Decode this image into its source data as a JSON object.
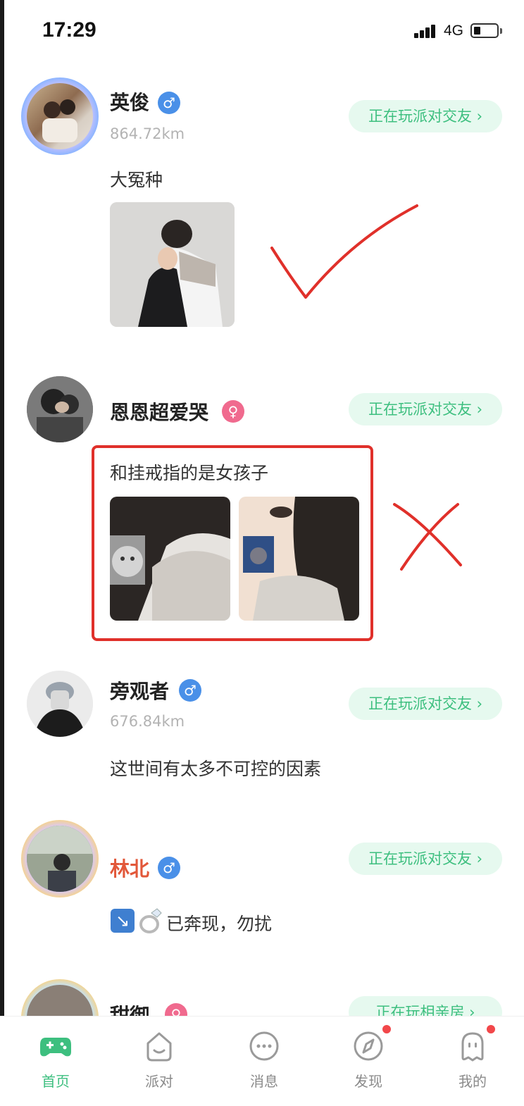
{
  "status_bar": {
    "time": "17:29",
    "network": "4G"
  },
  "posts": [
    {
      "username": "英俊",
      "gender": "male",
      "distance": "864.72km",
      "party_label": "正在玩派对交友",
      "text": "大冤种"
    },
    {
      "username": "恩恩超爱哭",
      "gender": "female",
      "party_label": "正在玩派对交友",
      "text": "和挂戒指的是女孩子"
    },
    {
      "username": "旁观者",
      "gender": "male",
      "distance": "676.84km",
      "party_label": "正在玩派对交友",
      "text": "这世间有太多不可控的因素"
    },
    {
      "username": "林北",
      "gender": "male",
      "party_label": "正在玩派对交友",
      "text": "已奔现，勿扰",
      "username_color": "#e2583a"
    },
    {
      "username": "甜御",
      "gender": "female",
      "party_label": "正在玩相亲房"
    }
  ],
  "tabbar": {
    "items": [
      {
        "label": "首页",
        "icon": "gamepad-icon",
        "active": true
      },
      {
        "label": "派对",
        "icon": "party-face-icon"
      },
      {
        "label": "消息",
        "icon": "message-bubble-icon"
      },
      {
        "label": "发现",
        "icon": "compass-icon",
        "badge": true
      },
      {
        "label": "我的",
        "icon": "profile-face-icon",
        "badge": true
      }
    ]
  },
  "colors": {
    "accent": "#3dbf7f",
    "party_bg": "#e6f9ef",
    "male": "#4a90e8",
    "female": "#f06a8e",
    "annotation": "#e0302a"
  }
}
